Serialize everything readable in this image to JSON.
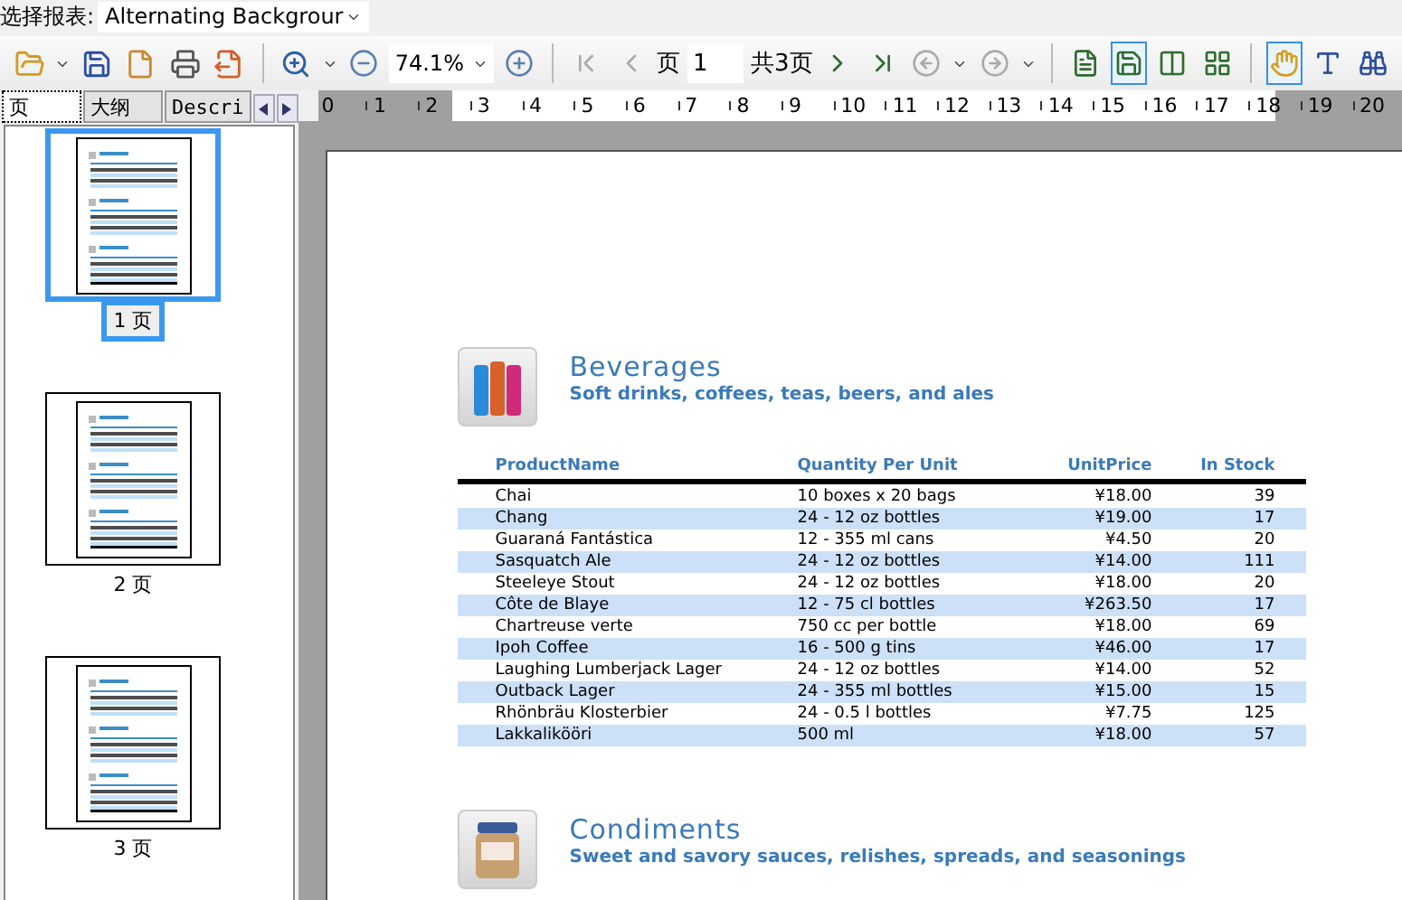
{
  "report_selector": {
    "label": "选择报表:",
    "value": "Alternating Backgrour"
  },
  "toolbar": {
    "zoom": "74.1%",
    "page_label": "页",
    "page_value": "1",
    "page_total": "共3页",
    "view_buttons": [
      {
        "selected": false
      },
      {
        "selected": true
      },
      {
        "selected": false
      },
      {
        "selected": false
      }
    ],
    "tool_buttons": [
      {
        "selected": true
      },
      {
        "selected": false
      },
      {
        "selected": false
      }
    ]
  },
  "sidebar": {
    "tabs": [
      {
        "label": "页",
        "selected": true
      },
      {
        "label": "大纲",
        "selected": false
      },
      {
        "label": "Descri",
        "selected": false
      }
    ],
    "thumbnails": [
      {
        "label": "1 页",
        "selected": true
      },
      {
        "label": "2 页",
        "selected": false
      },
      {
        "label": "3 页",
        "selected": false
      }
    ]
  },
  "ruler": [
    "0",
    "1",
    "2",
    "3",
    "4",
    "5",
    "6",
    "7",
    "8",
    "9",
    "10",
    "11",
    "12",
    "13",
    "14",
    "15",
    "16",
    "17",
    "18",
    "19",
    "20"
  ],
  "report": {
    "groups": [
      {
        "title": "Beverages",
        "subtitle": "Soft drinks, coffees, teas, beers, and ales",
        "kind": "bottles",
        "columns": [
          "ProductName",
          "Quantity Per Unit",
          "UnitPrice",
          "In Stock"
        ],
        "rows": [
          [
            "Chai",
            "10 boxes x 20 bags",
            "¥18.00",
            "39"
          ],
          [
            "Chang",
            "24 - 12 oz bottles",
            "¥19.00",
            "17"
          ],
          [
            "Guaraná Fantástica",
            "12 - 355 ml cans",
            "¥4.50",
            "20"
          ],
          [
            "Sasquatch Ale",
            "24 - 12 oz bottles",
            "¥14.00",
            "111"
          ],
          [
            "Steeleye Stout",
            "24 - 12 oz bottles",
            "¥18.00",
            "20"
          ],
          [
            "Côte de Blaye",
            "12 - 75 cl bottles",
            "¥263.50",
            "17"
          ],
          [
            "Chartreuse verte",
            "750 cc per bottle",
            "¥18.00",
            "69"
          ],
          [
            "Ipoh Coffee",
            "16 - 500 g tins",
            "¥46.00",
            "17"
          ],
          [
            "Laughing Lumberjack Lager",
            "24 - 12 oz bottles",
            "¥14.00",
            "52"
          ],
          [
            "Outback Lager",
            "24 - 355 ml bottles",
            "¥15.00",
            "15"
          ],
          [
            "Rhönbräu Klosterbier",
            "24 - 0.5 l bottles",
            "¥7.75",
            "125"
          ],
          [
            "Lakkalikööri",
            "500 ml",
            "¥18.00",
            "57"
          ]
        ]
      },
      {
        "title": "Condiments",
        "subtitle": "Sweet and savory sauces, relishes, spreads, and seasonings",
        "kind": "jar"
      }
    ]
  }
}
